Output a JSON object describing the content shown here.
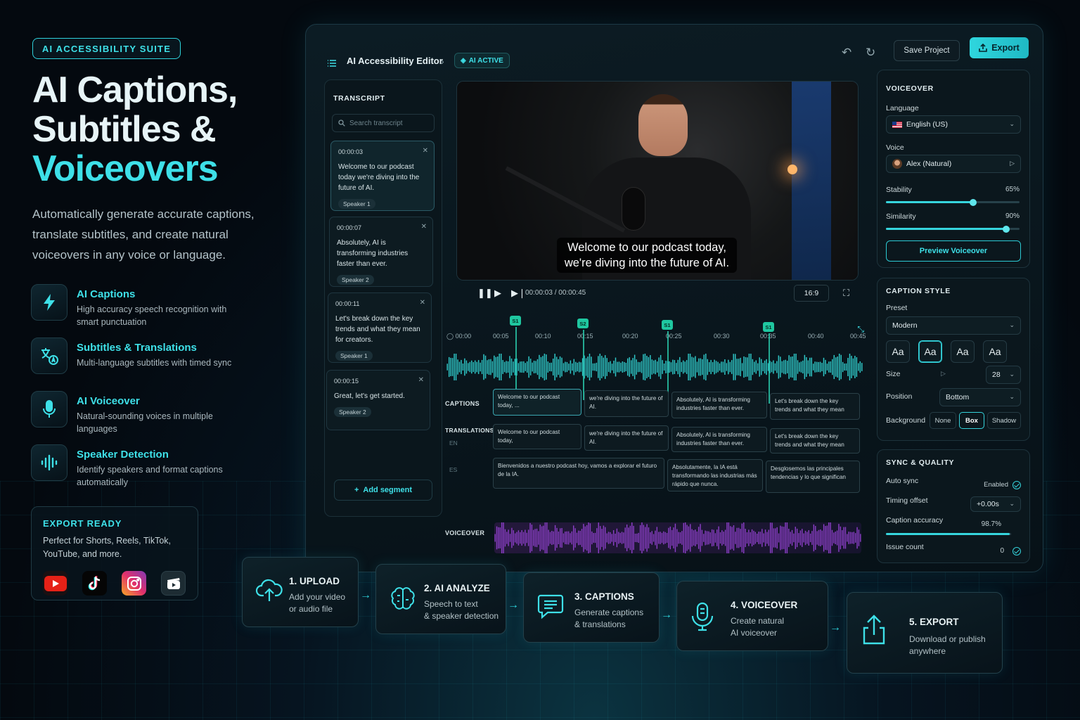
{
  "badge": "AI ACCESSIBILITY SUITE",
  "hero": {
    "line1": "AI Captions,",
    "line2": "Subtitles &",
    "line3": "Voiceovers"
  },
  "lead": "Automatically generate accurate captions, translate subtitles, and create natural voiceovers in any voice or language.",
  "features": [
    {
      "title": "AI Captions",
      "desc": "High accuracy speech recognition with smart punctuation",
      "icon": "lightning-icon"
    },
    {
      "title": "Subtitles & Translations",
      "desc": "Multi-language subtitles with timed sync",
      "icon": "translate-icon"
    },
    {
      "title": "AI Voiceover",
      "desc": "Natural-sounding voices in multiple languages",
      "icon": "microphone-icon"
    },
    {
      "title": "Speaker Detection",
      "desc": "Identify speakers and format captions automatically",
      "icon": "waveform-icon"
    }
  ],
  "export_ready": {
    "title": "EXPORT READY",
    "text": "Perfect for Shorts, Reels, TikTok, YouTube, and more."
  },
  "editor": {
    "title": "AI Accessibility Editor",
    "status": "AI ACTIVE",
    "save_label": "Save Project",
    "export_label": "Export"
  },
  "transcript": {
    "heading": "TRANSCRIPT",
    "search_placeholder": "Search transcript",
    "segments": [
      {
        "time": "00:00:03",
        "text": "Welcome to our podcast today we're diving into the future of AI.",
        "speaker": "Speaker 1"
      },
      {
        "time": "00:00:07",
        "text": "Absolutely, AI is transforming industries faster than ever.",
        "speaker": "Speaker 2"
      },
      {
        "time": "00:00:11",
        "text": "Let's break down the key trends and what they mean for creators.",
        "speaker": "Speaker 1"
      },
      {
        "time": "00:00:15",
        "text": "Great, let's get started.",
        "speaker": "Speaker 2"
      }
    ],
    "add_label": "Add segment"
  },
  "video": {
    "caption_line1": "Welcome to our podcast today,",
    "caption_line2": "we're diving into the future of AI.",
    "time": "00:00:03 / 00:00:45",
    "aspect": "16:9"
  },
  "timeline": {
    "ticks": [
      "00:00",
      "00:05",
      "00:10",
      "00:15",
      "00:20",
      "00:25",
      "00:30",
      "00:35",
      "00:40",
      "00:45"
    ],
    "markers": [
      "S1",
      "S2",
      "S1",
      "S1"
    ],
    "captions_label": "CAPTIONS",
    "translations_label": "TRANSLATIONS",
    "lang_en": "EN",
    "lang_es": "ES",
    "voiceover_label": "VOICEOVER",
    "captions": [
      "Welcome to our podcast today, ...",
      "we're diving into the future of AI.",
      "Absolutely, AI is transforming industries faster than ever.",
      "Let's break down the key trends and what they mean"
    ],
    "en": [
      "Welcome to our podcast today,",
      "we're diving into the future of AI.",
      "Absolutely, AI is transforming industries faster than ever.",
      "Let's break down the key trends and what they mean"
    ],
    "es": [
      "Bienvenidos a nuestro podcast hoy, vamos a explorar el futuro de la IA.",
      "Absolutamente, la IA está transformando las industrias más rápido que nunca.",
      "Desglosemos las principales tendencias y lo que significan"
    ]
  },
  "voiceover": {
    "heading": "VOICEOVER",
    "language_label": "Language",
    "language": "English (US)",
    "voice_label": "Voice",
    "voice": "Alex (Natural)",
    "stability_label": "Stability",
    "stability_text": "65%",
    "stability": 0.65,
    "similarity_label": "Similarity",
    "similarity_text": "90%",
    "similarity": 0.9,
    "preview_label": "Preview Voiceover"
  },
  "caption_style": {
    "heading": "CAPTION STYLE",
    "preset_label": "Preset",
    "preset": "Modern",
    "font_sample": "Aa",
    "size_label": "Size",
    "size": "28",
    "position_label": "Position",
    "position": "Bottom",
    "background_label": "Background",
    "bg_options": [
      "None",
      "Box",
      "Shadow"
    ]
  },
  "sync": {
    "heading": "SYNC & QUALITY",
    "auto_sync_label": "Auto sync",
    "auto_sync": "Enabled",
    "timing_label": "Timing offset",
    "timing": "+0.00s",
    "accuracy_label": "Caption accuracy",
    "accuracy_text": "98.7%",
    "accuracy": 0.987,
    "issue_label": "Issue count",
    "issue": "0"
  },
  "steps": [
    {
      "title": "1. UPLOAD",
      "line1": "Add your video",
      "line2": "or audio file",
      "icon": "cloud-upload-icon"
    },
    {
      "title": "2. AI ANALYZE",
      "line1": "Speech to text",
      "line2": "& speaker detection",
      "icon": "brain-icon"
    },
    {
      "title": "3. CAPTIONS",
      "line1": "Generate captions",
      "line2": "& translations",
      "icon": "caption-bubble-icon"
    },
    {
      "title": "4. VOICEOVER",
      "line1": "Create natural",
      "line2": "AI voiceover",
      "icon": "microphone-icon"
    },
    {
      "title": "5. EXPORT",
      "line1": "Download or publish",
      "line2": "anywhere",
      "icon": "share-upload-icon"
    }
  ]
}
